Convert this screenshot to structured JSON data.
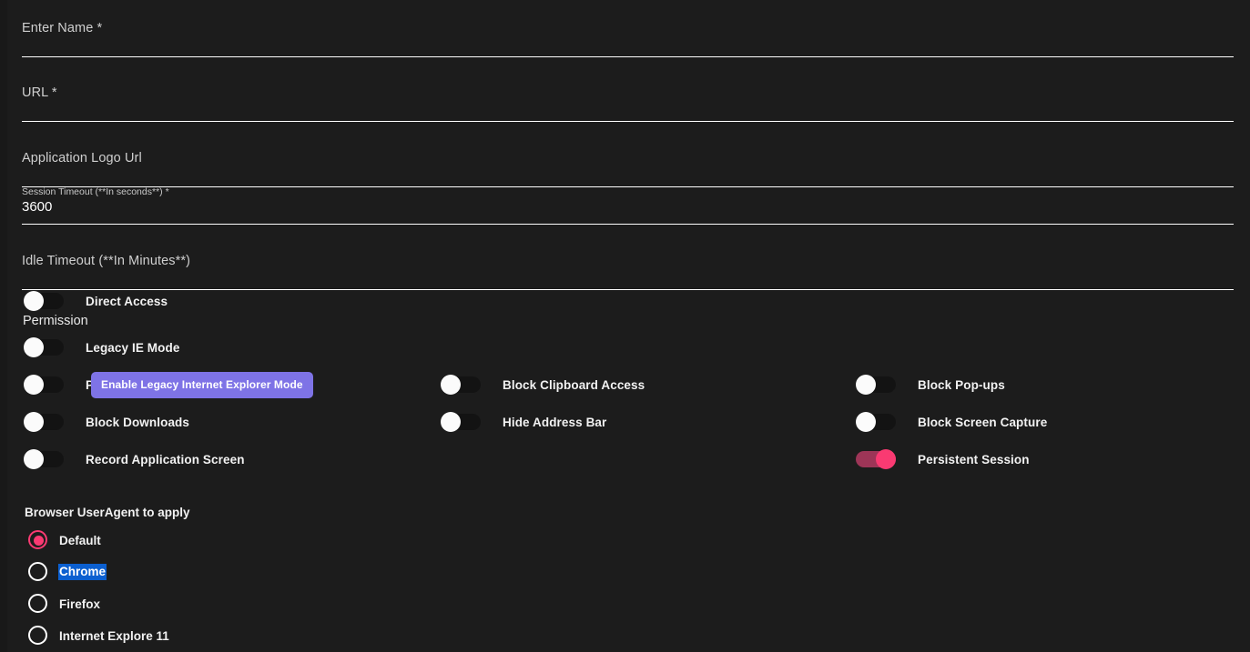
{
  "theme": {
    "background": "#1c1c1c",
    "accent_pink": "#fa3a72",
    "toggle_on_track": "#9d3557",
    "toggle_off_track": "#131313",
    "tooltip_background": "#7e73e6",
    "selection_highlight": "#0b5fd0",
    "underline": "#ffffff",
    "label_text": "#cfcfcf"
  },
  "form": {
    "fields": [
      {
        "id": "name",
        "label": "Enter Name *",
        "value": "",
        "floating": false
      },
      {
        "id": "url",
        "label": "URL *",
        "value": "",
        "floating": false
      },
      {
        "id": "logo",
        "label": "Application Logo Url",
        "value": "",
        "floating": false
      },
      {
        "id": "session",
        "label": "Session Timeout (**In seconds**) *",
        "value": "3600",
        "floating": true
      },
      {
        "id": "idle",
        "label": "Idle Timeout (**In Minutes**)",
        "value": "",
        "floating": false
      }
    ],
    "permission_text": "Permission"
  },
  "toggles": {
    "direct_access": {
      "label": "Direct Access",
      "on": false
    },
    "legacy_ie_mode": {
      "label": "Legacy IE Mode",
      "on": false
    },
    "prevent": {
      "label": "Prev",
      "on": false
    },
    "block_downloads": {
      "label": "Block Downloads",
      "on": false
    },
    "record_app_screen": {
      "label": "Record Application Screen",
      "on": false
    },
    "block_clipboard": {
      "label": "Block Clipboard Access",
      "on": false
    },
    "hide_address_bar": {
      "label": "Hide Address Bar",
      "on": false
    },
    "block_popups": {
      "label": "Block Pop-ups",
      "on": false
    },
    "block_screen_capture": {
      "label": "Block Screen Capture",
      "on": false
    },
    "persistent_session": {
      "label": "Persistent Session",
      "on": true
    }
  },
  "tooltip": {
    "text": "Enable Legacy Internet Explorer Mode"
  },
  "useragent": {
    "title": "Browser UserAgent to apply",
    "selected": "Default",
    "text_selected": "Chrome",
    "options": [
      {
        "label": "Default",
        "checked": true
      },
      {
        "label": "Chrome",
        "checked": false
      },
      {
        "label": "Firefox",
        "checked": false
      },
      {
        "label": "Internet Explore 11",
        "checked": false
      }
    ]
  }
}
